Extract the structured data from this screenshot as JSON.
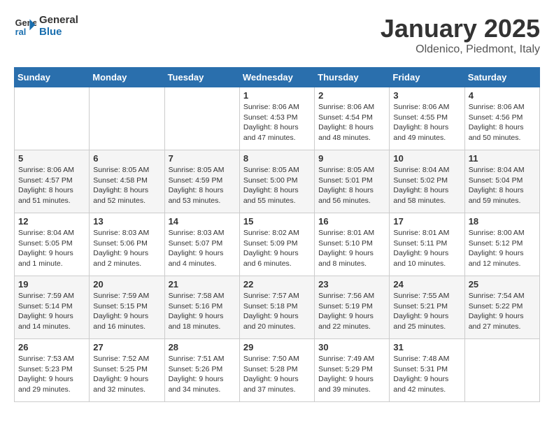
{
  "logo": {
    "line1": "General",
    "line2": "Blue"
  },
  "title": "January 2025",
  "subtitle": "Oldenico, Piedmont, Italy",
  "weekdays": [
    "Sunday",
    "Monday",
    "Tuesday",
    "Wednesday",
    "Thursday",
    "Friday",
    "Saturday"
  ],
  "weeks": [
    [
      {
        "day": "",
        "info": ""
      },
      {
        "day": "",
        "info": ""
      },
      {
        "day": "",
        "info": ""
      },
      {
        "day": "1",
        "info": "Sunrise: 8:06 AM\nSunset: 4:53 PM\nDaylight: 8 hours and 47 minutes."
      },
      {
        "day": "2",
        "info": "Sunrise: 8:06 AM\nSunset: 4:54 PM\nDaylight: 8 hours and 48 minutes."
      },
      {
        "day": "3",
        "info": "Sunrise: 8:06 AM\nSunset: 4:55 PM\nDaylight: 8 hours and 49 minutes."
      },
      {
        "day": "4",
        "info": "Sunrise: 8:06 AM\nSunset: 4:56 PM\nDaylight: 8 hours and 50 minutes."
      }
    ],
    [
      {
        "day": "5",
        "info": "Sunrise: 8:06 AM\nSunset: 4:57 PM\nDaylight: 8 hours and 51 minutes."
      },
      {
        "day": "6",
        "info": "Sunrise: 8:05 AM\nSunset: 4:58 PM\nDaylight: 8 hours and 52 minutes."
      },
      {
        "day": "7",
        "info": "Sunrise: 8:05 AM\nSunset: 4:59 PM\nDaylight: 8 hours and 53 minutes."
      },
      {
        "day": "8",
        "info": "Sunrise: 8:05 AM\nSunset: 5:00 PM\nDaylight: 8 hours and 55 minutes."
      },
      {
        "day": "9",
        "info": "Sunrise: 8:05 AM\nSunset: 5:01 PM\nDaylight: 8 hours and 56 minutes."
      },
      {
        "day": "10",
        "info": "Sunrise: 8:04 AM\nSunset: 5:02 PM\nDaylight: 8 hours and 58 minutes."
      },
      {
        "day": "11",
        "info": "Sunrise: 8:04 AM\nSunset: 5:04 PM\nDaylight: 8 hours and 59 minutes."
      }
    ],
    [
      {
        "day": "12",
        "info": "Sunrise: 8:04 AM\nSunset: 5:05 PM\nDaylight: 9 hours and 1 minute."
      },
      {
        "day": "13",
        "info": "Sunrise: 8:03 AM\nSunset: 5:06 PM\nDaylight: 9 hours and 2 minutes."
      },
      {
        "day": "14",
        "info": "Sunrise: 8:03 AM\nSunset: 5:07 PM\nDaylight: 9 hours and 4 minutes."
      },
      {
        "day": "15",
        "info": "Sunrise: 8:02 AM\nSunset: 5:09 PM\nDaylight: 9 hours and 6 minutes."
      },
      {
        "day": "16",
        "info": "Sunrise: 8:01 AM\nSunset: 5:10 PM\nDaylight: 9 hours and 8 minutes."
      },
      {
        "day": "17",
        "info": "Sunrise: 8:01 AM\nSunset: 5:11 PM\nDaylight: 9 hours and 10 minutes."
      },
      {
        "day": "18",
        "info": "Sunrise: 8:00 AM\nSunset: 5:12 PM\nDaylight: 9 hours and 12 minutes."
      }
    ],
    [
      {
        "day": "19",
        "info": "Sunrise: 7:59 AM\nSunset: 5:14 PM\nDaylight: 9 hours and 14 minutes."
      },
      {
        "day": "20",
        "info": "Sunrise: 7:59 AM\nSunset: 5:15 PM\nDaylight: 9 hours and 16 minutes."
      },
      {
        "day": "21",
        "info": "Sunrise: 7:58 AM\nSunset: 5:16 PM\nDaylight: 9 hours and 18 minutes."
      },
      {
        "day": "22",
        "info": "Sunrise: 7:57 AM\nSunset: 5:18 PM\nDaylight: 9 hours and 20 minutes."
      },
      {
        "day": "23",
        "info": "Sunrise: 7:56 AM\nSunset: 5:19 PM\nDaylight: 9 hours and 22 minutes."
      },
      {
        "day": "24",
        "info": "Sunrise: 7:55 AM\nSunset: 5:21 PM\nDaylight: 9 hours and 25 minutes."
      },
      {
        "day": "25",
        "info": "Sunrise: 7:54 AM\nSunset: 5:22 PM\nDaylight: 9 hours and 27 minutes."
      }
    ],
    [
      {
        "day": "26",
        "info": "Sunrise: 7:53 AM\nSunset: 5:23 PM\nDaylight: 9 hours and 29 minutes."
      },
      {
        "day": "27",
        "info": "Sunrise: 7:52 AM\nSunset: 5:25 PM\nDaylight: 9 hours and 32 minutes."
      },
      {
        "day": "28",
        "info": "Sunrise: 7:51 AM\nSunset: 5:26 PM\nDaylight: 9 hours and 34 minutes."
      },
      {
        "day": "29",
        "info": "Sunrise: 7:50 AM\nSunset: 5:28 PM\nDaylight: 9 hours and 37 minutes."
      },
      {
        "day": "30",
        "info": "Sunrise: 7:49 AM\nSunset: 5:29 PM\nDaylight: 9 hours and 39 minutes."
      },
      {
        "day": "31",
        "info": "Sunrise: 7:48 AM\nSunset: 5:31 PM\nDaylight: 9 hours and 42 minutes."
      },
      {
        "day": "",
        "info": ""
      }
    ]
  ]
}
